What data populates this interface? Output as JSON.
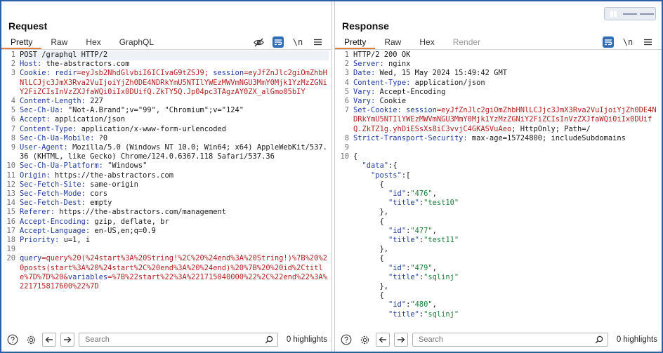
{
  "request": {
    "title": "Request",
    "tabs": [
      "Pretty",
      "Raw",
      "Hex",
      "GraphQL"
    ],
    "active_tab": "Pretty",
    "newline_label": "\\n",
    "search_placeholder": "Search",
    "highlights": "0 highlights",
    "lines": [
      {
        "n": "1",
        "segs": [
          {
            "t": "POST /graphql HTTP/2",
            "c": ""
          }
        ]
      },
      {
        "n": "2",
        "segs": [
          {
            "t": "Host:",
            "c": "hk"
          },
          {
            "t": " the-abstractors.com",
            "c": ""
          }
        ]
      },
      {
        "n": "3",
        "segs": [
          {
            "t": "Cookie:",
            "c": "hk"
          },
          {
            "t": " ",
            "c": ""
          },
          {
            "t": "redir",
            "c": "hk"
          },
          {
            "t": "=eyJsb2NhdGlvbiI6ICIvaG9tZSJ9; ",
            "c": "red"
          },
          {
            "t": "session",
            "c": "hk"
          },
          {
            "t": "=eyJfZnJlc2giOmZhbHNlLCJjc3JmX3Rva2VuIjoiYjZh0DE4NDRkYmU5NTIlYWEzMWVmNGU3MmY0Mjk1YzMzZGNiY2FiZCIsInVzZXJfaWQi0iIx0DUifQ.ZkTY5Q.Jp04pc3TAgzAY0ZX_alGmo05bIY",
            "c": "red"
          }
        ]
      },
      {
        "n": "4",
        "segs": [
          {
            "t": "Content-Length:",
            "c": "hk"
          },
          {
            "t": " 227",
            "c": ""
          }
        ]
      },
      {
        "n": "5",
        "segs": [
          {
            "t": "Sec-Ch-Ua:",
            "c": "hk"
          },
          {
            "t": " \"Not-A.Brand\";v=\"99\", \"Chromium\";v=\"124\"",
            "c": ""
          }
        ]
      },
      {
        "n": "6",
        "segs": [
          {
            "t": "Accept:",
            "c": "hk"
          },
          {
            "t": " application/json",
            "c": ""
          }
        ]
      },
      {
        "n": "7",
        "segs": [
          {
            "t": "Content-Type:",
            "c": "hk"
          },
          {
            "t": " application/x-www-form-urlencoded",
            "c": ""
          }
        ]
      },
      {
        "n": "8",
        "segs": [
          {
            "t": "Sec-Ch-Ua-Mobile:",
            "c": "hk"
          },
          {
            "t": " ?0",
            "c": ""
          }
        ]
      },
      {
        "n": "9",
        "segs": [
          {
            "t": "User-Agent:",
            "c": "hk"
          },
          {
            "t": " Mozilla/5.0 (Windows NT 10.0; Win64; x64) AppleWebKit/537.36 (KHTML, like Gecko) Chrome/124.0.6367.118 Safari/537.36",
            "c": ""
          }
        ]
      },
      {
        "n": "10",
        "segs": [
          {
            "t": "Sec-Ch-Ua-Platform:",
            "c": "hk"
          },
          {
            "t": " \"Windows\"",
            "c": ""
          }
        ]
      },
      {
        "n": "11",
        "segs": [
          {
            "t": "Origin:",
            "c": "hk"
          },
          {
            "t": " https://the-abstractors.com",
            "c": ""
          }
        ]
      },
      {
        "n": "12",
        "segs": [
          {
            "t": "Sec-Fetch-Site:",
            "c": "hk"
          },
          {
            "t": " same-origin",
            "c": ""
          }
        ]
      },
      {
        "n": "13",
        "segs": [
          {
            "t": "Sec-Fetch-Mode:",
            "c": "hk"
          },
          {
            "t": " cors",
            "c": ""
          }
        ]
      },
      {
        "n": "14",
        "segs": [
          {
            "t": "Sec-Fetch-Dest:",
            "c": "hk"
          },
          {
            "t": " empty",
            "c": ""
          }
        ]
      },
      {
        "n": "15",
        "segs": [
          {
            "t": "Referer:",
            "c": "hk"
          },
          {
            "t": " https://the-abstractors.com/management",
            "c": ""
          }
        ]
      },
      {
        "n": "16",
        "segs": [
          {
            "t": "Accept-Encoding:",
            "c": "hk"
          },
          {
            "t": " gzip, deflate, br",
            "c": ""
          }
        ]
      },
      {
        "n": "17",
        "segs": [
          {
            "t": "Accept-Language:",
            "c": "hk"
          },
          {
            "t": " en-US,en;q=0.9",
            "c": ""
          }
        ]
      },
      {
        "n": "18",
        "segs": [
          {
            "t": "Priority:",
            "c": "hk"
          },
          {
            "t": " u=1, i",
            "c": ""
          }
        ]
      },
      {
        "n": "19",
        "segs": [
          {
            "t": "",
            "c": ""
          }
        ]
      },
      {
        "n": "20",
        "segs": [
          {
            "t": "query",
            "c": "hk"
          },
          {
            "t": "=query%20(%24start%3A%20String!%2C%20%24end%3A%20String!)%7B%20%20posts(start%3A%20%24start%2C%20end%3A%20%24end)%20%7B%20%20id%2Ctitle%7D%7D%20&",
            "c": "red"
          },
          {
            "t": "variables",
            "c": "hk"
          },
          {
            "t": "=%7B%22start%22%3A%221715040000%22%2C%22end%22%3A%221715817600%22%7D",
            "c": "red"
          }
        ]
      }
    ]
  },
  "response": {
    "title": "Response",
    "tabs": [
      "Pretty",
      "Raw",
      "Hex",
      "Render"
    ],
    "active_tab": "Pretty",
    "newline_label": "\\n",
    "search_placeholder": "Search",
    "highlights": "0 highlights",
    "lines": [
      {
        "n": "1",
        "segs": [
          {
            "t": "HTTP/2 200 OK",
            "c": ""
          }
        ]
      },
      {
        "n": "2",
        "segs": [
          {
            "t": "Server:",
            "c": "hk"
          },
          {
            "t": " nginx",
            "c": ""
          }
        ]
      },
      {
        "n": "3",
        "segs": [
          {
            "t": "Date:",
            "c": "hk"
          },
          {
            "t": " Wed, 15 May 2024 15:49:42 GMT",
            "c": ""
          }
        ]
      },
      {
        "n": "4",
        "segs": [
          {
            "t": "Content-Type:",
            "c": "hk"
          },
          {
            "t": " application/json",
            "c": ""
          }
        ]
      },
      {
        "n": "5",
        "segs": [
          {
            "t": "Vary:",
            "c": "hk"
          },
          {
            "t": " Accept-Encoding",
            "c": ""
          }
        ]
      },
      {
        "n": "6",
        "segs": [
          {
            "t": "Vary:",
            "c": "hk"
          },
          {
            "t": " Cookie",
            "c": ""
          }
        ]
      },
      {
        "n": "7",
        "segs": [
          {
            "t": "Set-Cookie:",
            "c": "hk"
          },
          {
            "t": " ",
            "c": ""
          },
          {
            "t": "session",
            "c": "hk"
          },
          {
            "t": "=eyJfZnJlc2giOmZhbHNlLCJjc3JmX3Rva2VuIjoiYjZh0DE4NDRkYmU5NTIlYWEzMWVmNGU3MmY0Mjk1YzMzZGNiY2FiZCIsInVzZXJfaWQi0iIx0DUifQ.ZkTZ1g.yhDiESsXs8iC3vvjC4GKASVuAeo",
            "c": "red"
          },
          {
            "t": "; HttpOnly; Path=/",
            "c": ""
          }
        ]
      },
      {
        "n": "8",
        "segs": [
          {
            "t": "Strict-Transport-Security:",
            "c": "hk"
          },
          {
            "t": " max-age=15724800; includeSubdomains",
            "c": ""
          }
        ]
      },
      {
        "n": "9",
        "segs": [
          {
            "t": "",
            "c": ""
          }
        ]
      },
      {
        "n": "10",
        "segs": [
          {
            "t": "{",
            "c": ""
          }
        ]
      },
      {
        "n": "",
        "segs": [
          {
            "t": "  ",
            "c": ""
          },
          {
            "t": "\"data\"",
            "c": "jk"
          },
          {
            "t": ":{",
            "c": ""
          }
        ]
      },
      {
        "n": "",
        "segs": [
          {
            "t": "    ",
            "c": ""
          },
          {
            "t": "\"posts\"",
            "c": "jk"
          },
          {
            "t": ":[",
            "c": ""
          }
        ]
      },
      {
        "n": "",
        "segs": [
          {
            "t": "      {",
            "c": ""
          }
        ]
      },
      {
        "n": "",
        "segs": [
          {
            "t": "        ",
            "c": ""
          },
          {
            "t": "\"id\"",
            "c": "jk"
          },
          {
            "t": ":",
            "c": ""
          },
          {
            "t": "\"476\"",
            "c": "jv"
          },
          {
            "t": ",",
            "c": ""
          }
        ]
      },
      {
        "n": "",
        "segs": [
          {
            "t": "        ",
            "c": ""
          },
          {
            "t": "\"title\"",
            "c": "jk"
          },
          {
            "t": ":",
            "c": ""
          },
          {
            "t": "\"test10\"",
            "c": "jv"
          }
        ]
      },
      {
        "n": "",
        "segs": [
          {
            "t": "      },",
            "c": ""
          }
        ]
      },
      {
        "n": "",
        "segs": [
          {
            "t": "      {",
            "c": ""
          }
        ]
      },
      {
        "n": "",
        "segs": [
          {
            "t": "        ",
            "c": ""
          },
          {
            "t": "\"id\"",
            "c": "jk"
          },
          {
            "t": ":",
            "c": ""
          },
          {
            "t": "\"477\"",
            "c": "jv"
          },
          {
            "t": ",",
            "c": ""
          }
        ]
      },
      {
        "n": "",
        "segs": [
          {
            "t": "        ",
            "c": ""
          },
          {
            "t": "\"title\"",
            "c": "jk"
          },
          {
            "t": ":",
            "c": ""
          },
          {
            "t": "\"test11\"",
            "c": "jv"
          }
        ]
      },
      {
        "n": "",
        "segs": [
          {
            "t": "      },",
            "c": ""
          }
        ]
      },
      {
        "n": "",
        "segs": [
          {
            "t": "      {",
            "c": ""
          }
        ]
      },
      {
        "n": "",
        "segs": [
          {
            "t": "        ",
            "c": ""
          },
          {
            "t": "\"id\"",
            "c": "jk"
          },
          {
            "t": ":",
            "c": ""
          },
          {
            "t": "\"479\"",
            "c": "jv"
          },
          {
            "t": ",",
            "c": ""
          }
        ]
      },
      {
        "n": "",
        "segs": [
          {
            "t": "        ",
            "c": ""
          },
          {
            "t": "\"title\"",
            "c": "jk"
          },
          {
            "t": ":",
            "c": ""
          },
          {
            "t": "\"sqlinj\"",
            "c": "jv"
          }
        ]
      },
      {
        "n": "",
        "segs": [
          {
            "t": "      },",
            "c": ""
          }
        ]
      },
      {
        "n": "",
        "segs": [
          {
            "t": "      {",
            "c": ""
          }
        ]
      },
      {
        "n": "",
        "segs": [
          {
            "t": "        ",
            "c": ""
          },
          {
            "t": "\"id\"",
            "c": "jk"
          },
          {
            "t": ":",
            "c": ""
          },
          {
            "t": "\"480\"",
            "c": "jv"
          },
          {
            "t": ",",
            "c": ""
          }
        ]
      },
      {
        "n": "",
        "segs": [
          {
            "t": "        ",
            "c": ""
          },
          {
            "t": "\"title\"",
            "c": "jk"
          },
          {
            "t": ":",
            "c": ""
          },
          {
            "t": "\"sqlinj\"",
            "c": "jv"
          }
        ]
      }
    ]
  },
  "icons": {
    "eye_off": "eye-off-icon",
    "wrap": "wrap-icon",
    "menu": "menu-icon",
    "help": "help-icon",
    "settings": "gear-icon",
    "back": "arrow-left-icon",
    "forward": "arrow-right-icon",
    "search": "search-icon"
  },
  "colors": {
    "accent": "#2f6db5",
    "header_key": "#1f3c9e",
    "value_red": "#b22222",
    "json_string": "#1a7f37",
    "active_tab_underline": "#e07b39",
    "frame_border": "#2b5fa6"
  }
}
